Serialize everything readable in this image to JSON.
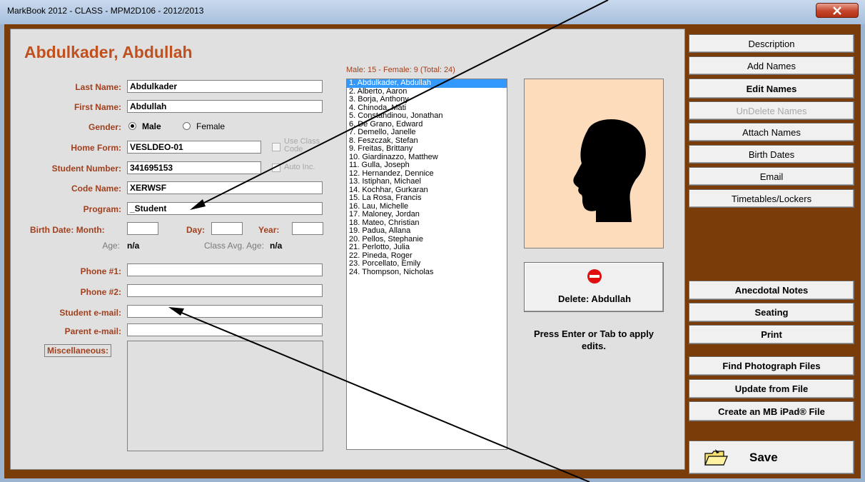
{
  "window": {
    "title": "MarkBook 2012 - CLASS - MPM2D106 - 2012/2013"
  },
  "student": {
    "heading": "Abdulkader, Abdullah",
    "last_name_label": "Last Name:",
    "last_name": "Abdulkader",
    "first_name_label": "First Name:",
    "first_name": "Abdullah",
    "gender_label": "Gender:",
    "gender_male": "Male",
    "gender_female": "Female",
    "gender_selected": "Male",
    "home_form_label": "Home Form:",
    "home_form": "VESLDEO-01",
    "use_class_code": "Use Class Code",
    "student_number_label": "Student Number:",
    "student_number": "341695153",
    "auto_inc": "Auto Inc.",
    "code_name_label": "Code Name:",
    "code_name": "XERWSF",
    "program_label": "Program:",
    "program": "_Student",
    "birth_date_label": "Birth Date:",
    "month_label": "Month:",
    "day_label": "Day:",
    "year_label": "Year:",
    "age_label": "Age:",
    "age": "n/a",
    "class_avg_age_label": "Class Avg. Age:",
    "class_avg_age": "n/a",
    "phone1_label": "Phone #1:",
    "phone2_label": "Phone #2:",
    "student_email_label": "Student e-mail:",
    "parent_email_label": "Parent e-mail:",
    "misc_label": "Miscellaneous:"
  },
  "roster": {
    "summary": "Male: 15 - Female: 9  (Total: 24)",
    "names": [
      "1. Abdulkader, Abdullah",
      "2. Alberto, Aaron",
      "3. Borja, Anthony",
      "4. Chinoda, Mati",
      "5. Constandinou, Jonathan",
      "6. De Grano, Edward",
      "7. Demello, Janelle",
      "8. Feszczak, Stefan",
      "9. Freitas, Brittany",
      "10. Giardinazzo, Matthew",
      "11. Gulla, Joseph",
      "12. Hernandez, Dennice",
      "13. Istiphan, Michael",
      "14. Kochhar, Gurkaran",
      "15. La Rosa, Francis",
      "16. Lau, Michelle",
      "17. Maloney, Jordan",
      "18. Mateo, Christian",
      "19. Padua, Allana",
      "20. Pellos, Stephanie",
      "21. Perlotto, Julia",
      "22. Pineda, Roger",
      "23. Porcellato, Emily",
      "24. Thompson, Nicholas"
    ],
    "selected_index": 0
  },
  "actions": {
    "delete_label": "Delete: Abdullah",
    "hint": "Press Enter or Tab to apply edits."
  },
  "sidebar": {
    "top_buttons": [
      "Description",
      "Add Names",
      "Edit Names",
      "UnDelete Names",
      "Attach Names",
      "Birth Dates",
      "Email",
      "Timetables/Lockers"
    ],
    "bottom_buttons": [
      "Anecdotal Notes",
      "Seating",
      "Print"
    ],
    "file_buttons": [
      "Find Photograph Files",
      "Update from File",
      "Create an MB iPad® File"
    ],
    "save_label": "Save"
  },
  "colors": {
    "frame": "#7a3d0a",
    "heading": "#c0501e",
    "label": "#a0401e",
    "photo_bg": "#fcdcbb",
    "selection": "#3399ff"
  }
}
